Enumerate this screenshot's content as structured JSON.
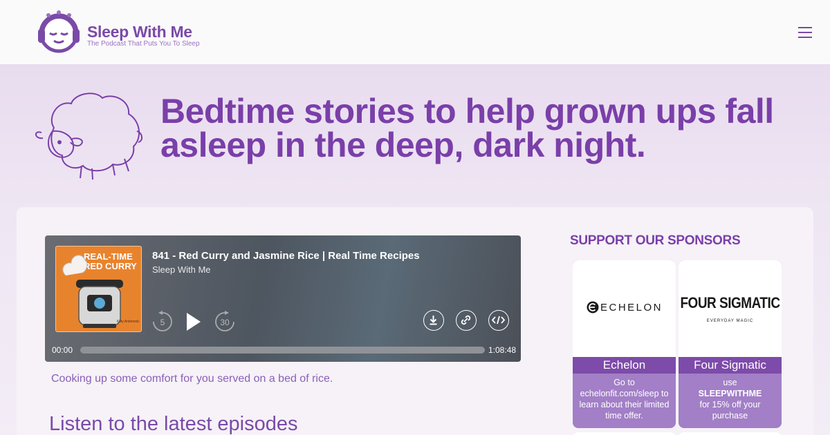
{
  "header": {
    "logo_name": "Sleep With Me",
    "logo_tagline": "The Podcast That Puts You To Sleep",
    "menu_icon": "hamburger-icon"
  },
  "hero": {
    "headline": "Bedtime stories to help grown ups fall asleep in the deep, dark night.",
    "illustration": "sheep-icon"
  },
  "player": {
    "cover_title": "REAL-TIME RED CURRY",
    "cover_signature": "Kitty Antimonic",
    "episode_title": "841 - Red Curry and Jasmine Rice | Real Time Recipes",
    "show_name": "Sleep With Me",
    "rewind_seconds": "5",
    "forward_seconds": "30",
    "time_current": "00:00",
    "time_total": "1:08:48",
    "progress_fraction": 0
  },
  "episode_description": "Cooking up some comfort for you served on a bed of rice.",
  "latest_heading": "Listen to the latest episodes",
  "sponsors": {
    "title": "SUPPORT OUR SPONSORS",
    "items": [
      {
        "logo_text": "ECHELON",
        "name": "Echelon",
        "offer": "Go to echelonfit.com/sleep to learn about their limited time offer."
      },
      {
        "logo_text": "FOUR SIGMATIC",
        "logo_sub": "EVERYDAY MAGIC",
        "name": "Four Sigmatic",
        "offer_pre": "use",
        "offer_code": "SLEEPWITHME",
        "offer_post": "for 15% off your purchase"
      }
    ]
  },
  "colors": {
    "brand_purple": "#7a3fa9",
    "sponsor_bar": "#7d4ba9",
    "sponsor_body": "#a27fc6",
    "cover_orange": "#e8832d"
  }
}
